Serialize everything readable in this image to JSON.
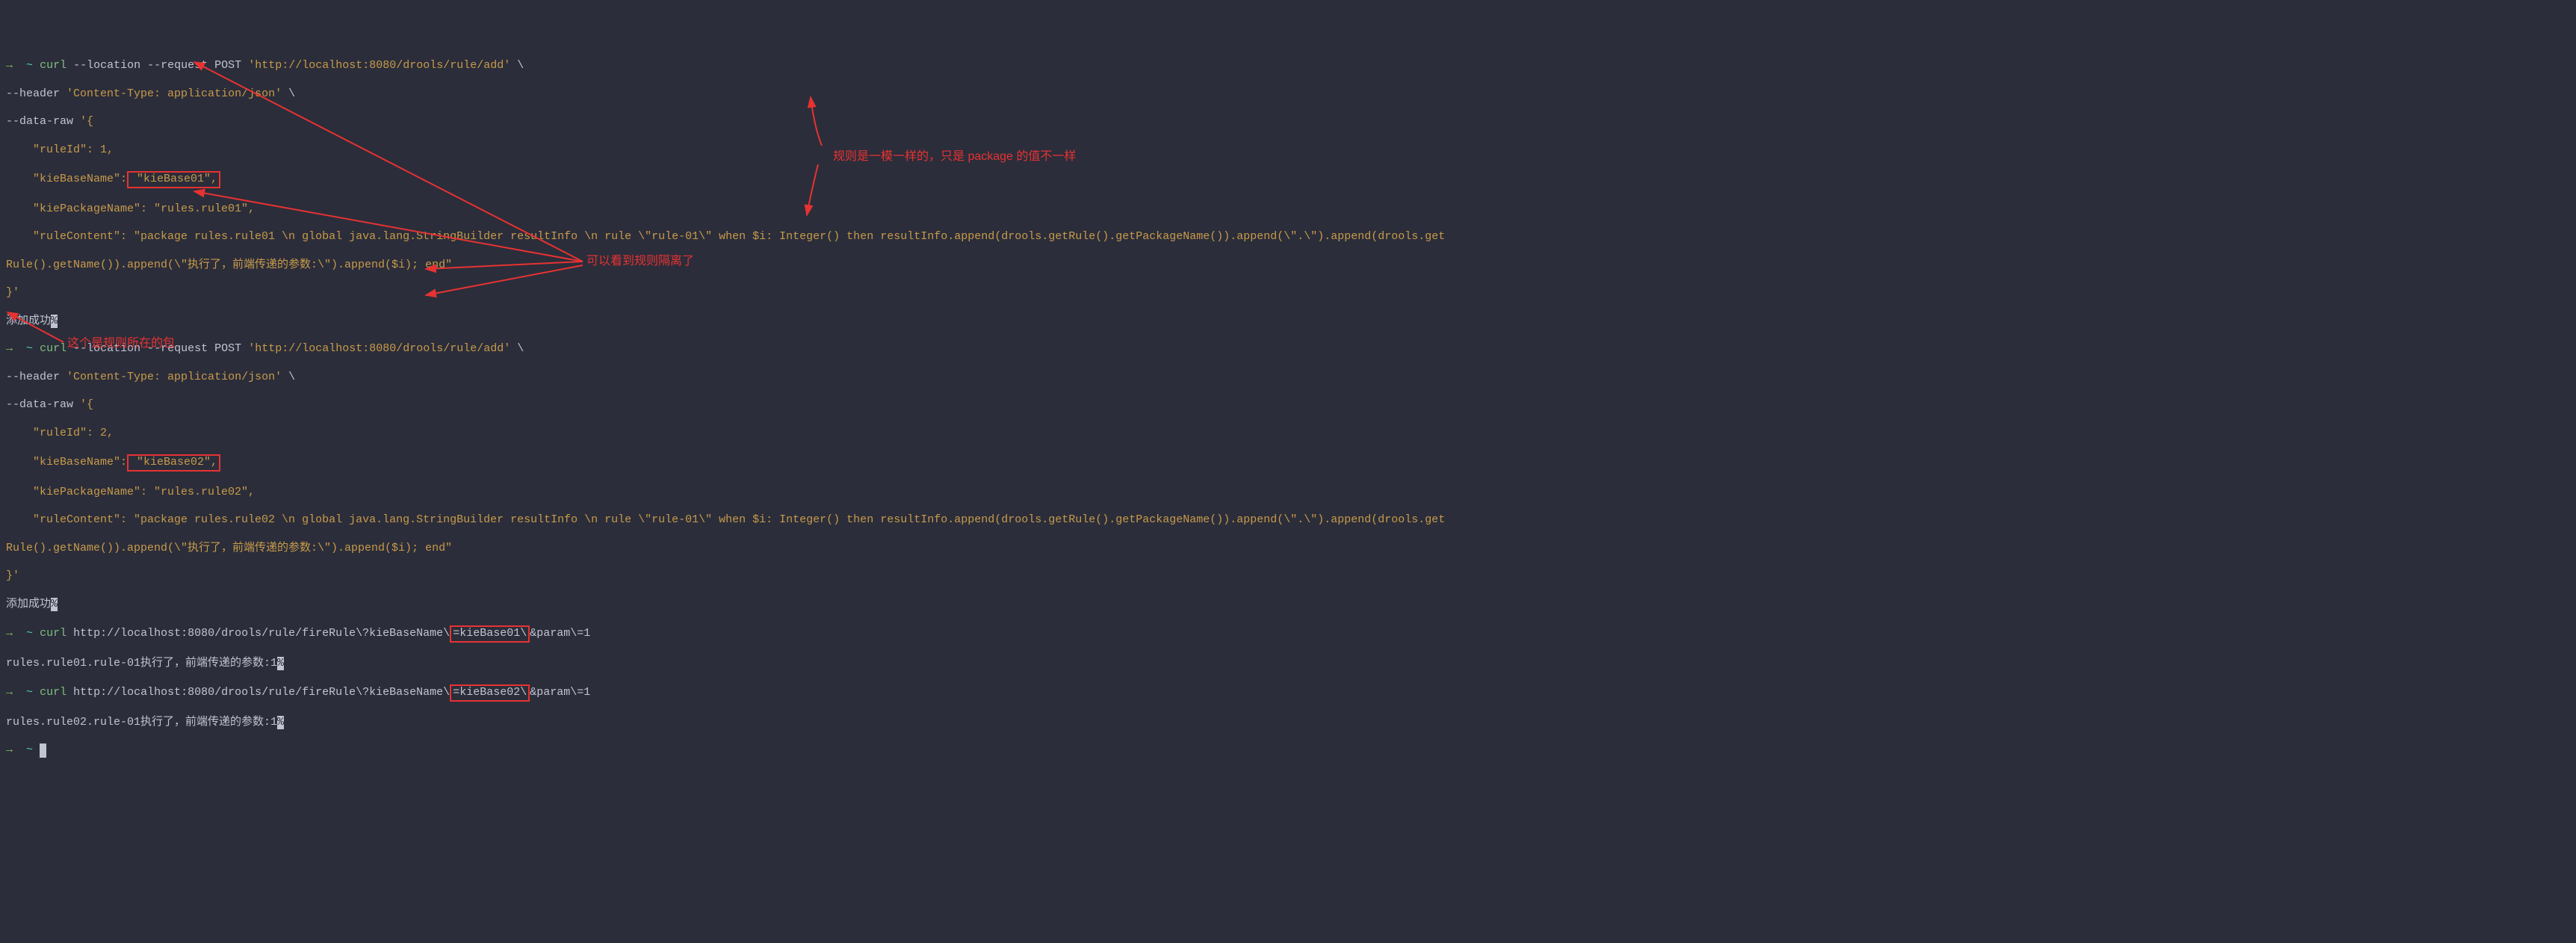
{
  "prompt": {
    "arrow": "→",
    "tilde": "~"
  },
  "request1": {
    "curl_cmd": "curl",
    "loc_flag": "--location",
    "req_flag": "--request",
    "method": "POST",
    "url": "'http://localhost:8080/drools/rule/add'",
    "backslash": "\\",
    "header_flag": "--header",
    "header_value": "'Content-Type: application/json'",
    "data_flag": "--data-raw",
    "data_open": "'{",
    "ruleId_line": "    \"ruleId\": 1,",
    "kieBaseName_key": "    \"kieBaseName\":",
    "kieBaseName_val": " \"kieBase01\",",
    "kiePackageName_line": "    \"kiePackageName\": \"rules.rule01\",",
    "ruleContent_line": "    \"ruleContent\": \"package rules.rule01 \\n global java.lang.StringBuilder resultInfo \\n rule \\\"rule-01\\\" when $i: Integer() then resultInfo.append(drools.getRule().getPackageName()).append(\\\".\\\").append(drools.get",
    "ruleContent_line2": "Rule().getName()).append(\\\"执行了，前端传递的参数:\\\").append($i); end\"",
    "close": "}'",
    "result": "添加成功"
  },
  "request2": {
    "curl_cmd": "curl",
    "loc_flag": "--location",
    "req_flag": "--request",
    "method": "POST",
    "url": "'http://localhost:8080/drools/rule/add'",
    "backslash": "\\",
    "header_flag": "--header",
    "header_value": "'Content-Type: application/json'",
    "data_flag": "--data-raw",
    "data_open": "'{",
    "ruleId_line": "    \"ruleId\": 2,",
    "kieBaseName_key": "    \"kieBaseName\":",
    "kieBaseName_val": " \"kieBase02\",",
    "kiePackageName_line": "    \"kiePackageName\": \"rules.rule02\",",
    "ruleContent_line": "    \"ruleContent\": \"package rules.rule02 \\n global java.lang.StringBuilder resultInfo \\n rule \\\"rule-01\\\" when $i: Integer() then resultInfo.append(drools.getRule().getPackageName()).append(\\\".\\\").append(drools.get",
    "ruleContent_line2": "Rule().getName()).append(\\\"执行了，前端传递的参数:\\\").append($i); end\"",
    "close": "}'",
    "result": "添加成功"
  },
  "fire1": {
    "curl_cmd": "curl",
    "url_pre": "http://localhost:8080/drools/rule/fireRule\\?kieBaseName\\",
    "url_mid": "=kieBase01\\",
    "url_post": "&param\\=1",
    "result": "rules.rule01.rule-01执行了，前端传递的参数:1"
  },
  "fire2": {
    "curl_cmd": "curl",
    "url_pre": "http://localhost:8080/drools/rule/fireRule\\?kieBaseName\\",
    "url_mid": "=kieBase02\\",
    "url_post": "&param\\=1",
    "result": "rules.rule02.rule-01执行了，前端传递的参数:1"
  },
  "box_char": "%",
  "annotations": {
    "a1": "规则是一模一样的，只是 package 的值不一样",
    "a2": "可以看到规则隔离了",
    "a3": "这个是规则所在的包"
  }
}
